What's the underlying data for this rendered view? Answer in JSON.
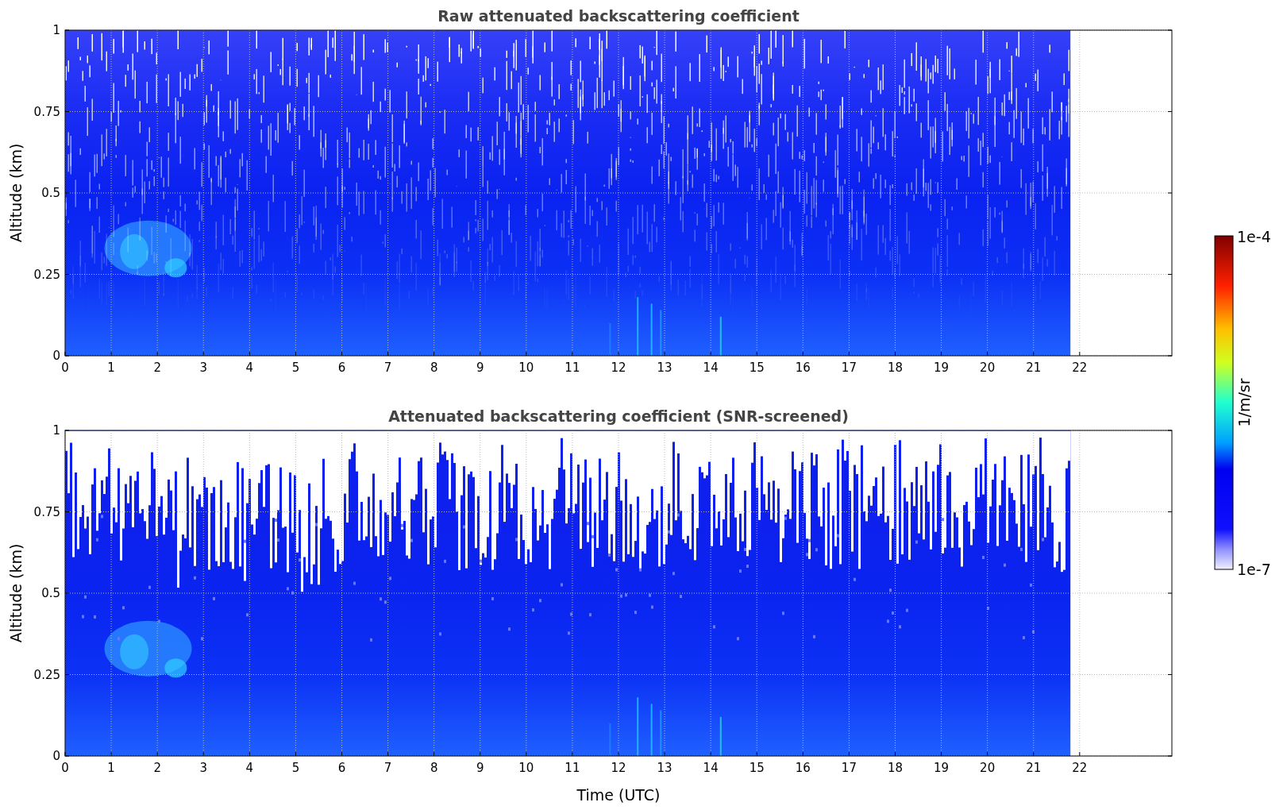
{
  "panels": [
    {
      "title": "Raw attenuated backscattering coefficient",
      "ylabel": "Altitude (km)",
      "yticks": [
        "1",
        "0.75",
        "0.5",
        "0.25",
        "0"
      ],
      "xticks": [
        "0",
        "1",
        "2",
        "3",
        "4",
        "5",
        "6",
        "7",
        "8",
        "9",
        "10",
        "11",
        "12",
        "13",
        "14",
        "15",
        "16",
        "17",
        "18",
        "19",
        "20",
        "21",
        "22"
      ],
      "kind": "raw"
    },
    {
      "title": "Attenuated backscattering coefficient (SNR-screened)",
      "ylabel": "Altitude (km)",
      "yticks": [
        "1",
        "0.75",
        "0.5",
        "0.25",
        "0"
      ],
      "xticks": [
        "0",
        "1",
        "2",
        "3",
        "4",
        "5",
        "6",
        "7",
        "8",
        "9",
        "10",
        "11",
        "12",
        "13",
        "14",
        "15",
        "16",
        "17",
        "18",
        "19",
        "20",
        "21",
        "22"
      ],
      "xlabel": "Time (UTC)",
      "kind": "screened"
    }
  ],
  "colorbar": {
    "max_label": "1e-4",
    "min_label": "1e-7",
    "label": "1/m/sr"
  }
}
